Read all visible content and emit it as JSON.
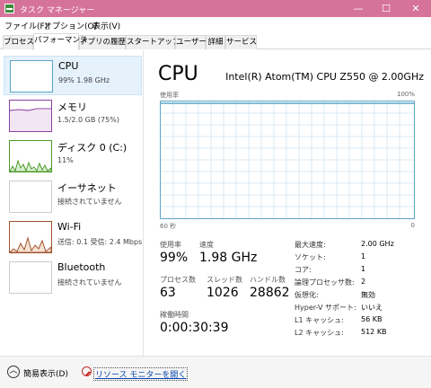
{
  "window": {
    "title": "タスク マネージャー",
    "min_glyph": "—",
    "max_glyph": "☐",
    "close_glyph": "✕"
  },
  "menu": [
    "ファイル(F)",
    "オプション(O)",
    "表示(V)"
  ],
  "tabs": [
    {
      "label": "プロセス",
      "active": false
    },
    {
      "label": "パフォーマンス",
      "active": true
    },
    {
      "label": "アプリの履歴",
      "active": false
    },
    {
      "label": "スタートアップ",
      "active": false
    },
    {
      "label": "ユーザー",
      "active": false
    },
    {
      "label": "詳細",
      "active": false
    },
    {
      "label": "サービス",
      "active": false
    }
  ],
  "sidebar": [
    {
      "name": "CPU",
      "sub": "99% 1.98 GHz",
      "active": true
    },
    {
      "name": "メモリ",
      "sub": "1.5/2.0 GB (75%)",
      "active": false
    },
    {
      "name": "ディスク 0 (C:)",
      "sub": "11%",
      "active": false
    },
    {
      "name": "イーサネット",
      "sub": "接続されていません",
      "active": false
    },
    {
      "name": "Wi-Fi",
      "sub": "送信: 0.1  受信: 2.4 Mbps",
      "active": false
    },
    {
      "name": "Bluetooth",
      "sub": "接続されていません",
      "active": false
    }
  ],
  "main": {
    "title": "CPU",
    "model": "Intel(R) Atom(TM) CPU Z550 @ 2.00GHz",
    "graph": {
      "label_top_left": "使用率",
      "label_top_right": "100%",
      "label_bottom_left": "60 秒",
      "label_bottom_right": "0"
    },
    "stats": {
      "usage_label": "使用率",
      "usage_value": "99%",
      "speed_label": "速度",
      "speed_value": "1.98 GHz",
      "processes_label": "プロセス数",
      "processes_value": "63",
      "threads_label": "スレッド数",
      "threads_value": "1026",
      "handles_label": "ハンドル数",
      "handles_value": "28862",
      "uptime_label": "稼働時間",
      "uptime_value": "0:00:30:39"
    },
    "info": [
      {
        "label": "最大速度:",
        "value": "2.00 GHz"
      },
      {
        "label": "ソケット:",
        "value": "1"
      },
      {
        "label": "コア:",
        "value": "1"
      },
      {
        "label": "論理プロセッサ数:",
        "value": "2"
      },
      {
        "label": "仮想化:",
        "value": "無効"
      },
      {
        "label": "Hyper-V サポート:",
        "value": "いいえ"
      },
      {
        "label": "L1 キャッシュ:",
        "value": "56 KB"
      },
      {
        "label": "L2 キャッシュ:",
        "value": "512 KB"
      }
    ]
  },
  "footer": {
    "less_label": "簡易表示(D)",
    "resource_link": "リソース モニターを開く",
    "collapse_glyph": "︿"
  },
  "colors": {
    "titlebar": "#d6739b",
    "graph_border": "#5aa5c8",
    "memory_line": "#8b3fa0",
    "disk_line": "#4c9a2a",
    "wifi_line": "#a0522d"
  }
}
